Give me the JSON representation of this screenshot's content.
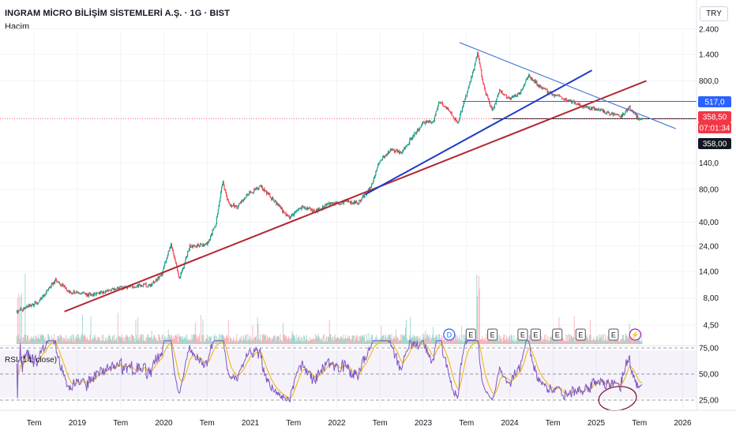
{
  "header": {
    "title": "INGRAM MİCRO BİLİŞİM SİSTEMLERİ A.Ş. · 1G · BIST",
    "volume_label": "Hacim",
    "currency_button": "TRY"
  },
  "chart_data": {
    "type": "candlestick",
    "symbol": "INGRAM MİCRO BİLİŞİM SİSTEMLERİ A.Ş.",
    "interval": "1G",
    "exchange": "BIST",
    "currency": "TRY",
    "price_scale": "log",
    "price_axis_ticks": [
      "2.400",
      "1.400",
      "800,0",
      "140,0",
      "80,00",
      "40,00",
      "24,00",
      "14,00",
      "8,00",
      "4,50"
    ],
    "price_axis_values": [
      2400,
      1400,
      800,
      140,
      80,
      40,
      24,
      14,
      8,
      4.5
    ],
    "time_axis_ticks": [
      "Tem",
      "2019",
      "Tem",
      "2020",
      "Tem",
      "2021",
      "Tem",
      "2022",
      "Tem",
      "2023",
      "Tem",
      "2024",
      "Tem",
      "2025",
      "Tem",
      "2026"
    ],
    "price_points": [
      {
        "t": 2018.3,
        "p": 6.0
      },
      {
        "t": 2018.55,
        "p": 7.3
      },
      {
        "t": 2018.75,
        "p": 11.8
      },
      {
        "t": 2018.9,
        "p": 9.2
      },
      {
        "t": 2019.15,
        "p": 8.5
      },
      {
        "t": 2019.35,
        "p": 9.3
      },
      {
        "t": 2019.6,
        "p": 10.3
      },
      {
        "t": 2019.85,
        "p": 10.5
      },
      {
        "t": 2019.98,
        "p": 13.5
      },
      {
        "t": 2020.08,
        "p": 25.0
      },
      {
        "t": 2020.18,
        "p": 12.0
      },
      {
        "t": 2020.3,
        "p": 24.0
      },
      {
        "t": 2020.5,
        "p": 25.0
      },
      {
        "t": 2020.6,
        "p": 38.0
      },
      {
        "t": 2020.68,
        "p": 95.0
      },
      {
        "t": 2020.75,
        "p": 58.0
      },
      {
        "t": 2020.85,
        "p": 55.0
      },
      {
        "t": 2020.95,
        "p": 70.0
      },
      {
        "t": 2021.12,
        "p": 85.0
      },
      {
        "t": 2021.3,
        "p": 60.0
      },
      {
        "t": 2021.45,
        "p": 43.0
      },
      {
        "t": 2021.6,
        "p": 55.0
      },
      {
        "t": 2021.75,
        "p": 50.0
      },
      {
        "t": 2021.9,
        "p": 58.0
      },
      {
        "t": 2022.1,
        "p": 62.0
      },
      {
        "t": 2022.25,
        "p": 60.0
      },
      {
        "t": 2022.4,
        "p": 85.0
      },
      {
        "t": 2022.48,
        "p": 140.0
      },
      {
        "t": 2022.62,
        "p": 185.0
      },
      {
        "t": 2022.75,
        "p": 175.0
      },
      {
        "t": 2022.9,
        "p": 260.0
      },
      {
        "t": 2023.0,
        "p": 330.0
      },
      {
        "t": 2023.12,
        "p": 340.0
      },
      {
        "t": 2023.18,
        "p": 520.0
      },
      {
        "t": 2023.3,
        "p": 420.0
      },
      {
        "t": 2023.4,
        "p": 330.0
      },
      {
        "t": 2023.5,
        "p": 600.0
      },
      {
        "t": 2023.58,
        "p": 1000.0
      },
      {
        "t": 2023.63,
        "p": 1450.0
      },
      {
        "t": 2023.7,
        "p": 700.0
      },
      {
        "t": 2023.8,
        "p": 420.0
      },
      {
        "t": 2023.88,
        "p": 650.0
      },
      {
        "t": 2024.0,
        "p": 550.0
      },
      {
        "t": 2024.12,
        "p": 620.0
      },
      {
        "t": 2024.22,
        "p": 900.0
      },
      {
        "t": 2024.35,
        "p": 700.0
      },
      {
        "t": 2024.5,
        "p": 600.0
      },
      {
        "t": 2024.7,
        "p": 520.0
      },
      {
        "t": 2024.85,
        "p": 460.0
      },
      {
        "t": 2025.0,
        "p": 440.0
      },
      {
        "t": 2025.15,
        "p": 400.0
      },
      {
        "t": 2025.28,
        "p": 370.0
      },
      {
        "t": 2025.38,
        "p": 460.0
      },
      {
        "t": 2025.48,
        "p": 365.0
      },
      {
        "t": 2025.53,
        "p": 358.5
      }
    ],
    "price_labels": [
      {
        "text": "517,0",
        "value": 517.0,
        "bg": "#2962ff",
        "fg": "#ffffff"
      },
      {
        "text": "358,50",
        "value": 358.5,
        "bg": "#f23645",
        "fg": "#ffffff"
      },
      {
        "text": "07:01:34",
        "value": 358.5,
        "bg": "#f23645",
        "fg": "#ffffff"
      },
      {
        "text": "358,00",
        "value": 358.0,
        "bg": "#131722",
        "fg": "#ffffff"
      }
    ],
    "trendlines": [
      {
        "name": "red-support",
        "color": "#b22833",
        "from": {
          "t": 2018.85,
          "p": 6.0
        },
        "to": {
          "t": 2025.58,
          "p": 800.0
        }
      },
      {
        "name": "blue-channel",
        "color": "#1e3cc8",
        "from": {
          "t": 2022.33,
          "p": 72.0
        },
        "to": {
          "t": 2024.95,
          "p": 1000.0
        }
      },
      {
        "name": "descending-resistance",
        "color": "#4a7bd0",
        "from": {
          "t": 2023.42,
          "p": 1800.0
        },
        "to": {
          "t": 2025.92,
          "p": 290.0
        }
      }
    ],
    "horizontal_levels": [
      {
        "value": 517.0,
        "color": "#2962ff",
        "from_t": 2023.45
      },
      {
        "value": 358.0,
        "color": "#131722",
        "from_t": 2023.8
      }
    ],
    "event_markers": [
      {
        "label": "D",
        "t": 2023.3,
        "type": "dividend"
      },
      {
        "label": "E",
        "t": 2023.55,
        "type": "earnings"
      },
      {
        "label": "E",
        "t": 2023.8,
        "type": "earnings"
      },
      {
        "label": "E",
        "t": 2024.15,
        "type": "earnings"
      },
      {
        "label": "E",
        "t": 2024.3,
        "type": "earnings"
      },
      {
        "label": "E",
        "t": 2024.55,
        "type": "earnings"
      },
      {
        "label": "E",
        "t": 2024.82,
        "type": "earnings"
      },
      {
        "label": "E",
        "t": 2025.2,
        "type": "earnings"
      },
      {
        "label": "⚡",
        "t": 2025.45,
        "type": "split"
      }
    ],
    "rsi": {
      "label": "RSI (14, close)",
      "axis_ticks": [
        "75,00",
        "50,00",
        "25,00"
      ],
      "axis_values": [
        75,
        50,
        25
      ],
      "band_upper": 70,
      "band_lower": 30,
      "line_color": "#7e57c2",
      "signal_color": "#f0b400"
    },
    "colors": {
      "up": "#089981",
      "down": "#f23645"
    }
  }
}
